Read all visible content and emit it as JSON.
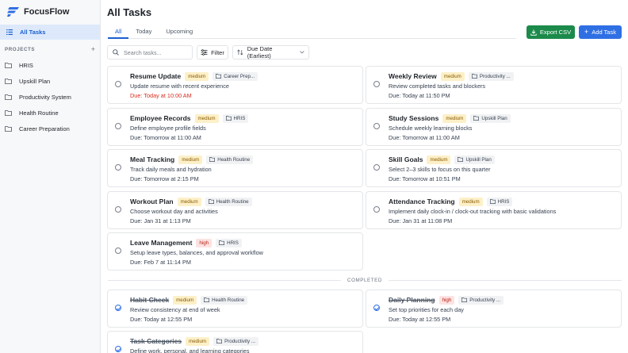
{
  "app": {
    "name": "FocusFlow"
  },
  "sidebar": {
    "all_tasks_label": "All Tasks",
    "projects_header": "PROJECTS",
    "projects": [
      "HRIS",
      "Upskill Plan",
      "Productivity System",
      "Health Routine",
      "Career Preparation"
    ]
  },
  "page": {
    "title": "All Tasks"
  },
  "tabs": {
    "all": "All",
    "today": "Today",
    "upcoming": "Upcoming",
    "active": "All"
  },
  "toolbar": {
    "export_label": "Export CSV",
    "add_label": "Add Task",
    "search_placeholder": "Search tasks...",
    "filter_label": "Filter",
    "sort_value": "Due Date (Earliest)"
  },
  "colors": {
    "accent": "#2f6fe4",
    "export": "#1b8a4a",
    "overdue": "#d92d20",
    "medium": "#fdf0c8",
    "high": "#fde2e2"
  },
  "tasks": [
    {
      "name": "Resume Update",
      "priority": "medium",
      "project": "Career Prep...",
      "description": "Update resume with recent experience",
      "due": "Due: Today at 10:00 AM",
      "overdue": true,
      "completed": false
    },
    {
      "name": "Weekly Review",
      "priority": "medium",
      "project": "Productivity ...",
      "description": "Review completed tasks and blockers",
      "due": "Due: Today at 11:50 PM",
      "overdue": false,
      "completed": false
    },
    {
      "name": "Employee Records",
      "priority": "medium",
      "project": "HRIS",
      "description": "Define employee profile fields",
      "due": "Due: Tomorrow at 11:00 AM",
      "overdue": false,
      "completed": false
    },
    {
      "name": "Study Sessions",
      "priority": "medium",
      "project": "Upskill Plan",
      "description": "Schedule weekly learning blocks",
      "due": "Due: Tomorrow at 11:00 AM",
      "overdue": false,
      "completed": false
    },
    {
      "name": "Meal Tracking",
      "priority": "medium",
      "project": "Health Routine",
      "description": "Track daily meals and hydration",
      "due": "Due: Tomorrow at 2:15 PM",
      "overdue": false,
      "completed": false
    },
    {
      "name": "Skill Goals",
      "priority": "medium",
      "project": "Upskill Plan",
      "description": "Select 2–3 skills to focus on this quarter",
      "due": "Due: Tomorrow at 10:51 PM",
      "overdue": false,
      "completed": false
    },
    {
      "name": "Workout Plan",
      "priority": "medium",
      "project": "Health Routine",
      "description": "Choose workout day and activities",
      "due": "Due: Jan 31 at 1:13 PM",
      "overdue": false,
      "completed": false
    },
    {
      "name": "Attendance Tracking",
      "priority": "medium",
      "project": "HRIS",
      "description": "Implement daily clock-in / clock-out tracking with basic validations",
      "due": "Due: Jan 31 at 11:08 PM",
      "overdue": false,
      "completed": false
    },
    {
      "name": "Leave Management",
      "priority": "high",
      "project": "HRIS",
      "description": "Setup leave types, balances, and approval workflow",
      "due": "Due: Feb 7 at 11:14 PM",
      "overdue": false,
      "completed": false
    }
  ],
  "completed_label": "COMPLETED",
  "completed_tasks": [
    {
      "name": "Habit Check",
      "priority": "medium",
      "project": "Health Routine",
      "description": "Review consistency at end of week",
      "due": "Due: Today at 12:55 PM",
      "completed": true
    },
    {
      "name": "Daily Planning",
      "priority": "high",
      "project": "Productivity ...",
      "description": "Set top priorities for each day",
      "due": "Due: Today at 12:55 PM",
      "completed": true
    },
    {
      "name": "Task Categories",
      "priority": "medium",
      "project": "Productivity ...",
      "description": "Define work, personal, and learning categories",
      "due": "",
      "completed": true
    }
  ]
}
